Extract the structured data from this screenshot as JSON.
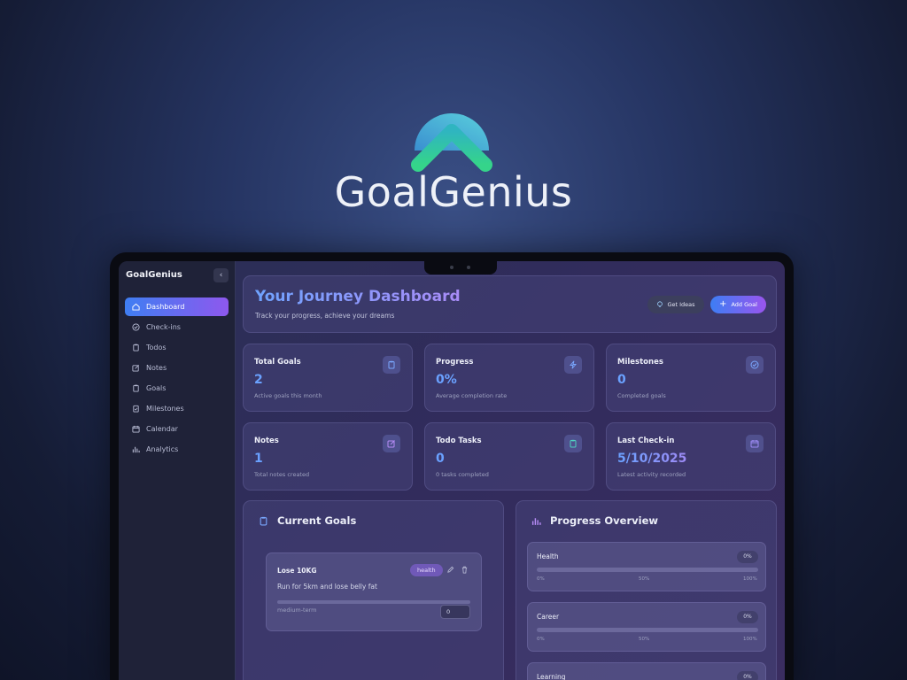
{
  "brand": {
    "name": "GoalGenius",
    "logo_colors": {
      "arc_top": "#54c8e0",
      "arc_left": "#3a8fd0",
      "chevron": "#2fce92"
    }
  },
  "sidebar": {
    "title": "GoalGenius",
    "collapse_icon": "chevron-left-icon",
    "items": [
      {
        "label": "Dashboard",
        "icon": "home-icon",
        "active": true
      },
      {
        "label": "Check-ins",
        "icon": "check-circle-icon"
      },
      {
        "label": "Todos",
        "icon": "clipboard-icon"
      },
      {
        "label": "Notes",
        "icon": "edit-icon"
      },
      {
        "label": "Goals",
        "icon": "clipboard-icon"
      },
      {
        "label": "Milestones",
        "icon": "clipboard-check-icon"
      },
      {
        "label": "Calendar",
        "icon": "calendar-icon"
      },
      {
        "label": "Analytics",
        "icon": "bar-chart-icon"
      }
    ]
  },
  "header": {
    "title": "Your Journey Dashboard",
    "subtitle": "Track your progress, achieve your dreams",
    "ideas_button": "Get Ideas",
    "add_button": "Add Goal"
  },
  "stats": [
    {
      "label": "Total Goals",
      "value": "2",
      "desc": "Active goals this month",
      "icon": "clipboard-icon",
      "icon_color": "#7aa8ff"
    },
    {
      "label": "Progress",
      "value": "0%",
      "desc": "Average completion rate",
      "icon": "lightning-icon",
      "icon_color": "#7aa8ff"
    },
    {
      "label": "Milestones",
      "value": "0",
      "desc": "Completed goals",
      "icon": "check-circle-icon",
      "icon_color": "#7aa8ff"
    },
    {
      "label": "Notes",
      "value": "1",
      "desc": "Total notes created",
      "icon": "edit-icon",
      "icon_color": "#b78cf7"
    },
    {
      "label": "Todo Tasks",
      "value": "0",
      "desc": "0 tasks completed",
      "icon": "clipboard-icon",
      "icon_color": "#4fd1c0"
    },
    {
      "label": "Last Check-in",
      "value": "5/10/2025",
      "desc": "Latest activity recorded",
      "icon": "calendar-icon",
      "icon_color": "#9d8af5"
    }
  ],
  "current_goals": {
    "title": "Current Goals",
    "goal": {
      "title": "Lose 10KG",
      "tag": "health",
      "description": "Run for 5km and lose belly fat",
      "term": "medium-term",
      "progress_input": "0",
      "progress": 0
    }
  },
  "progress_overview": {
    "title": "Progress Overview",
    "items": [
      {
        "label": "Health",
        "percent": "0%",
        "progress": 0,
        "ticks": [
          "0%",
          "50%",
          "100%"
        ]
      },
      {
        "label": "Career",
        "percent": "0%",
        "progress": 0,
        "ticks": [
          "0%",
          "50%",
          "100%"
        ]
      },
      {
        "label": "Learning",
        "percent": "0%",
        "progress": 0
      }
    ]
  }
}
